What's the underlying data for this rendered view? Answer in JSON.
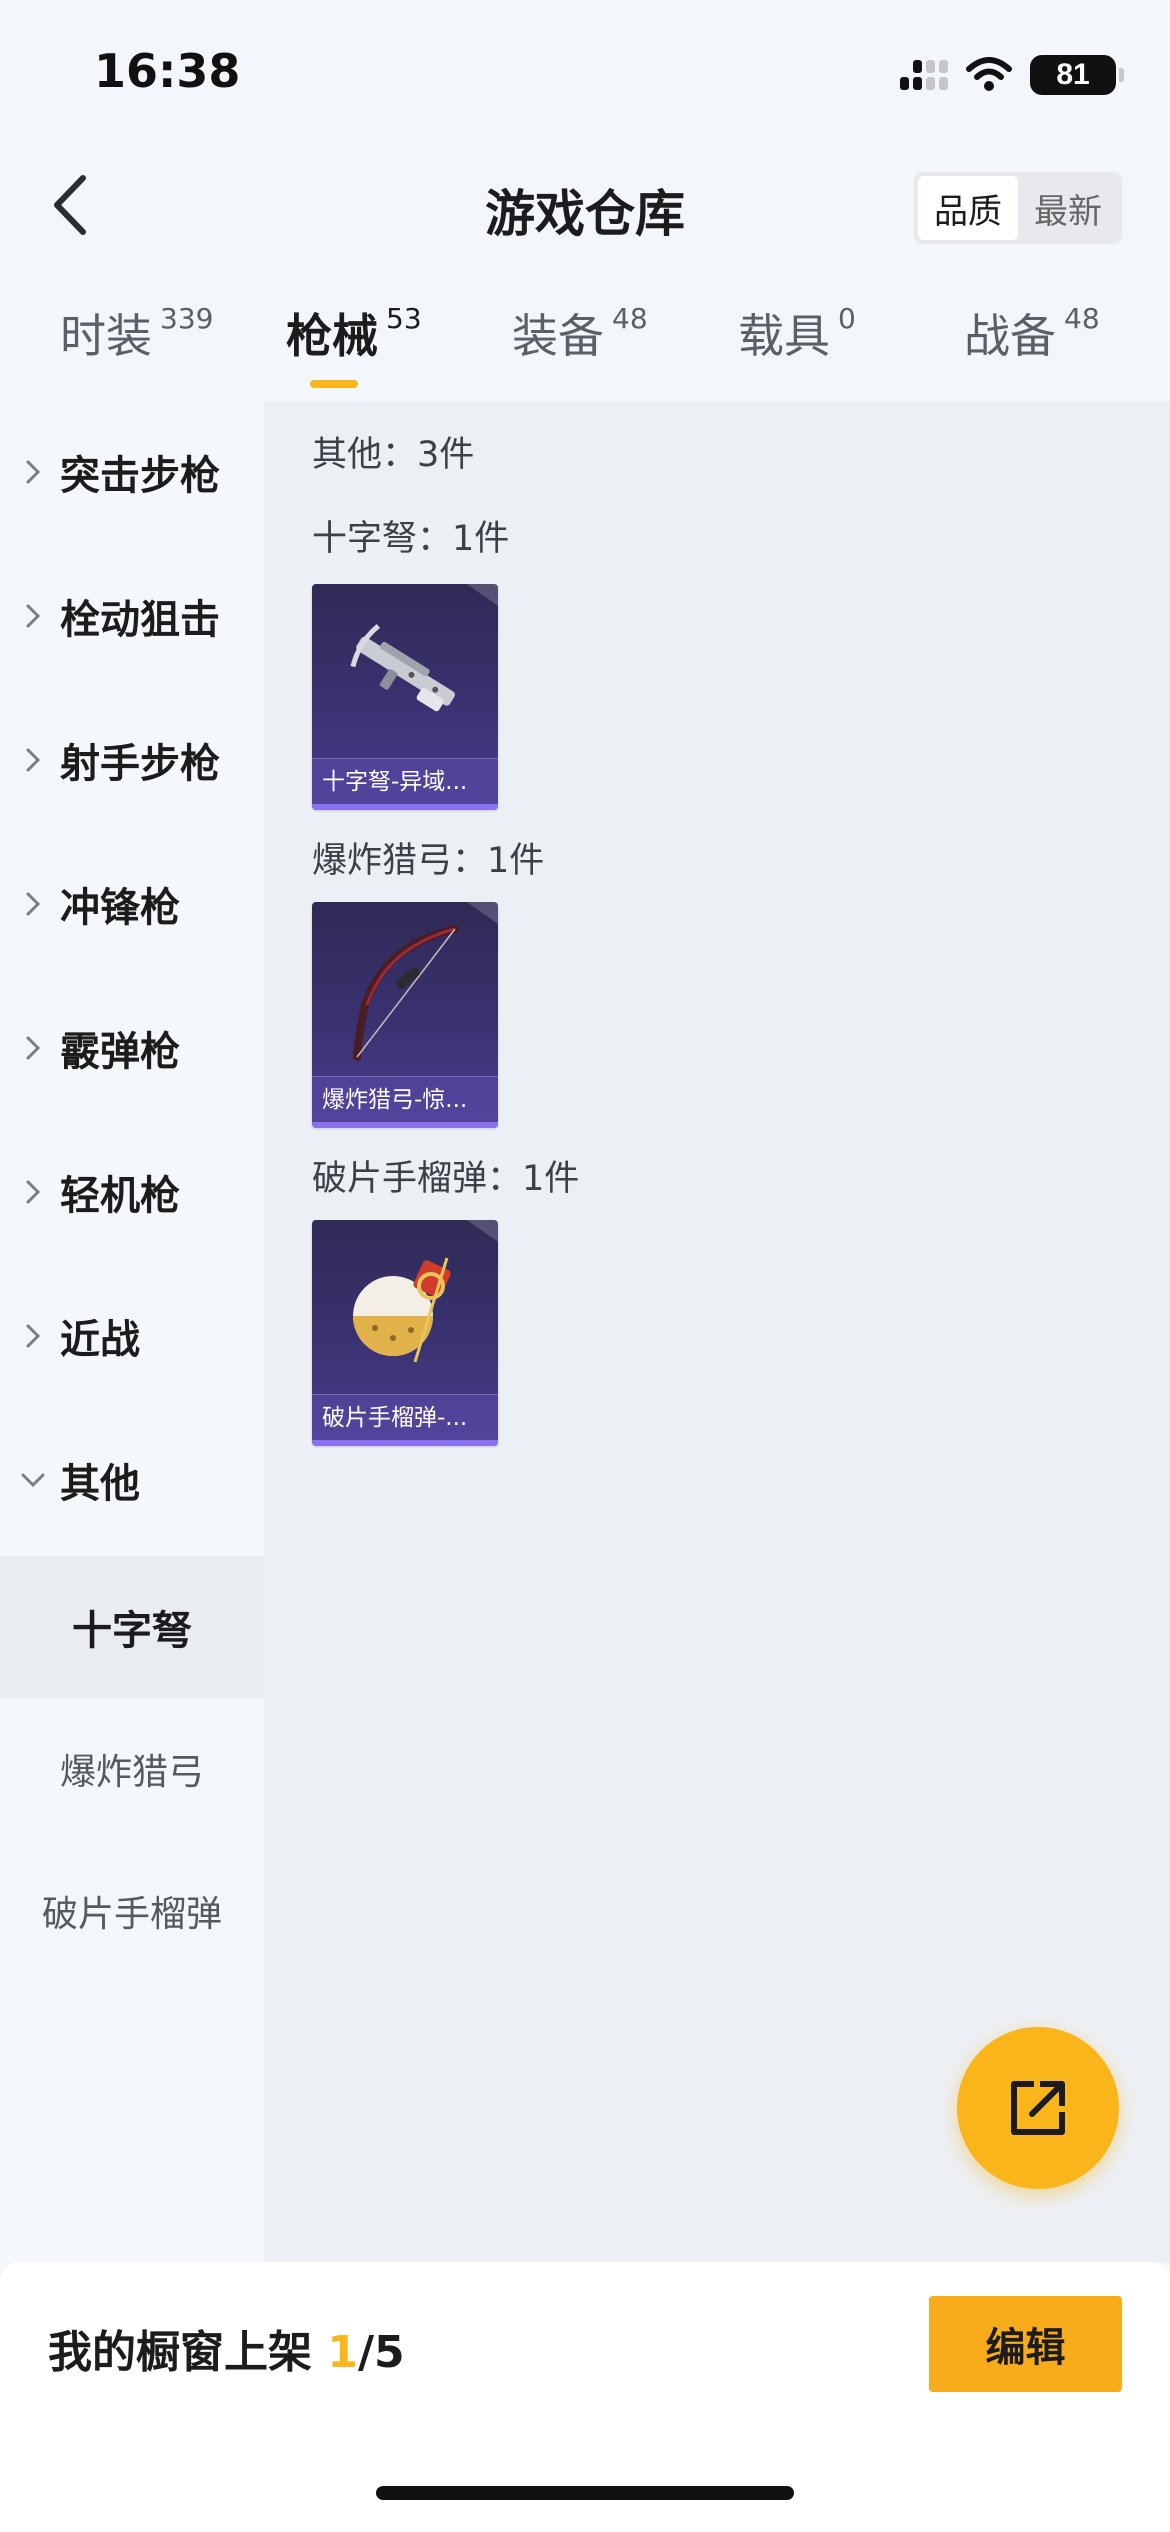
{
  "status_bar": {
    "time": "16:38",
    "battery": "81"
  },
  "header": {
    "title": "游戏仓库",
    "sort_options": [
      "品质",
      "最新"
    ],
    "sort_selected": "品质"
  },
  "tabs": [
    {
      "label": "时装",
      "count": "339"
    },
    {
      "label": "枪械",
      "count": "53"
    },
    {
      "label": "装备",
      "count": "48"
    },
    {
      "label": "载具",
      "count": "0"
    },
    {
      "label": "战备",
      "count": "48"
    }
  ],
  "active_tab": "枪械",
  "sidebar": {
    "categories": [
      "突击步枪",
      "栓动狙击",
      "射手步枪",
      "冲锋枪",
      "霰弹枪",
      "轻机枪",
      "近战",
      "其他"
    ],
    "expanded": "其他",
    "subcategories": [
      "十字弩",
      "爆炸猎弓",
      "破片手榴弹"
    ],
    "selected_sub": "十字弩"
  },
  "content": {
    "summary": "其他：3件",
    "groups": [
      {
        "heading": "十字弩：1件",
        "item_caption": "十字弩-异域...",
        "icon": "crossbow-icon"
      },
      {
        "heading": "爆炸猎弓：1件",
        "item_caption": "爆炸猎弓-惊...",
        "icon": "bow-icon"
      },
      {
        "heading": "破片手榴弹：1件",
        "item_caption": "破片手榴弹-...",
        "icon": "grenade-icon"
      }
    ]
  },
  "bottom_bar": {
    "showcase_label": "我的橱窗上架 ",
    "showcase_current": "1",
    "showcase_total": "/5",
    "edit_label": "编辑"
  },
  "colors": {
    "accent": "#f8b51c",
    "card_bg": "#3b3272",
    "card_bar": "#8a72ee"
  }
}
